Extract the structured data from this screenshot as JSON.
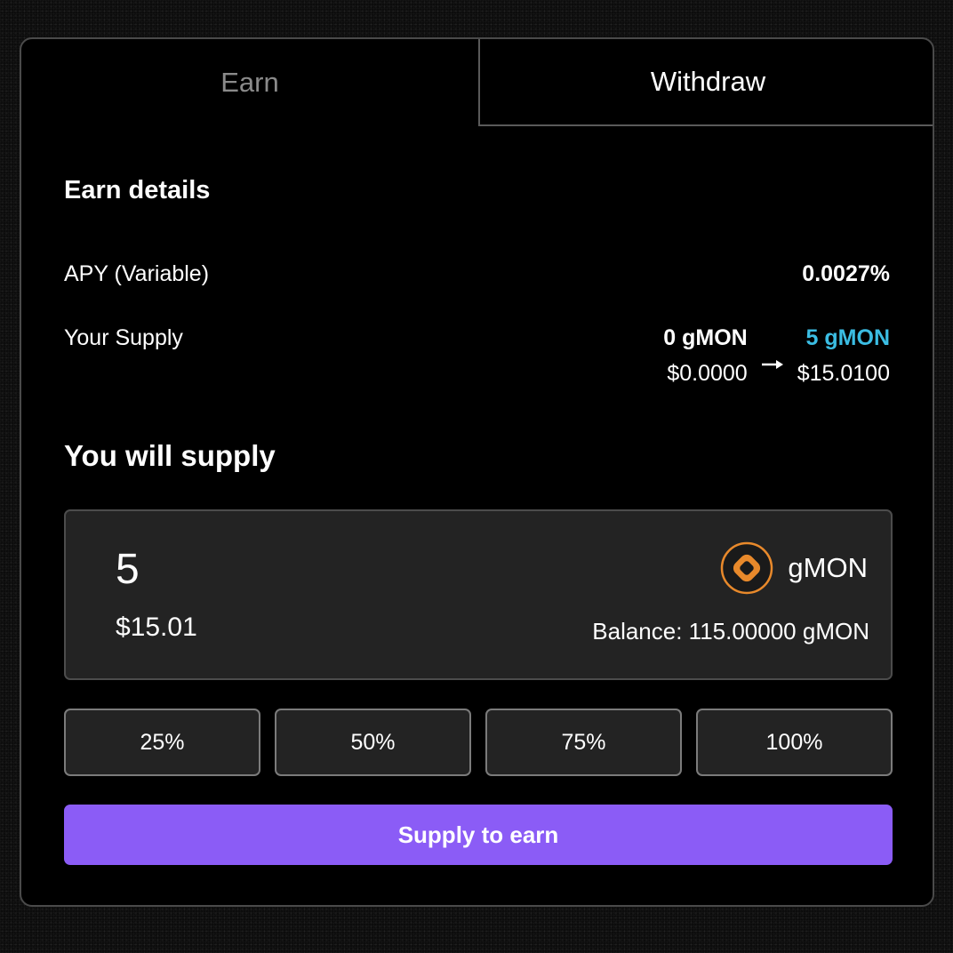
{
  "tabs": {
    "earn": "Earn",
    "withdraw": "Withdraw"
  },
  "earn_details": {
    "title": "Earn details",
    "apy_label": "APY (Variable)",
    "apy_value": "0.0027%",
    "supply_label": "Your Supply",
    "supply_current_amount": "0 gMON",
    "supply_current_usd": "$0.0000",
    "supply_next_amount": "5 gMON",
    "supply_next_usd": "$15.0100"
  },
  "supply_input": {
    "title": "You will supply",
    "amount": "5",
    "amount_usd": "$15.01",
    "token": "gMON",
    "token_icon": "gmon-token-icon",
    "balance": "Balance: 115.00000 gMON"
  },
  "percent_buttons": [
    "25%",
    "50%",
    "75%",
    "100%"
  ],
  "action": {
    "label": "Supply to earn"
  },
  "colors": {
    "accent_purple": "#8b5cf6",
    "highlight_blue": "#3bbde3",
    "token_orange": "#e8892b"
  }
}
